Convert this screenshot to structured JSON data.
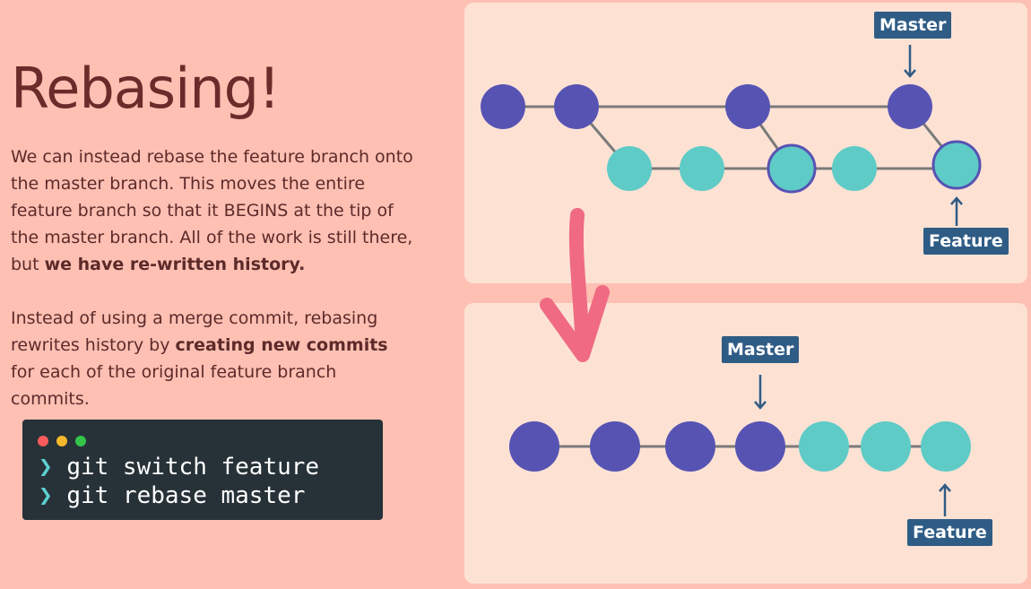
{
  "title": "Rebasing!",
  "paragraph1": {
    "text": "We can instead rebase the feature branch onto the master branch.  This moves the entire feature branch so that it BEGINS at the tip of the master branch.  All of the work is still there, but ",
    "bold": "we have re-written history."
  },
  "paragraph2": {
    "before": "Instead of using a merge commit, rebasing rewrites history by ",
    "bold": "creating new commits",
    "after": " for each of the original feature branch commits."
  },
  "terminal": {
    "prompt": "❯",
    "commands": [
      "git switch feature",
      "git rebase master"
    ]
  },
  "diagram_before": {
    "master_label": "Master",
    "feature_label": "Feature"
  },
  "diagram_after": {
    "master_label": "Master",
    "feature_label": "Feature"
  },
  "colors": {
    "master_commit": "#5753b3",
    "feature_commit": "#5fcbc7",
    "label_bg": "#2f5c85",
    "arrow_pink": "#ef6a82",
    "background": "#fdc0b3",
    "panel": "#fde2d4"
  }
}
